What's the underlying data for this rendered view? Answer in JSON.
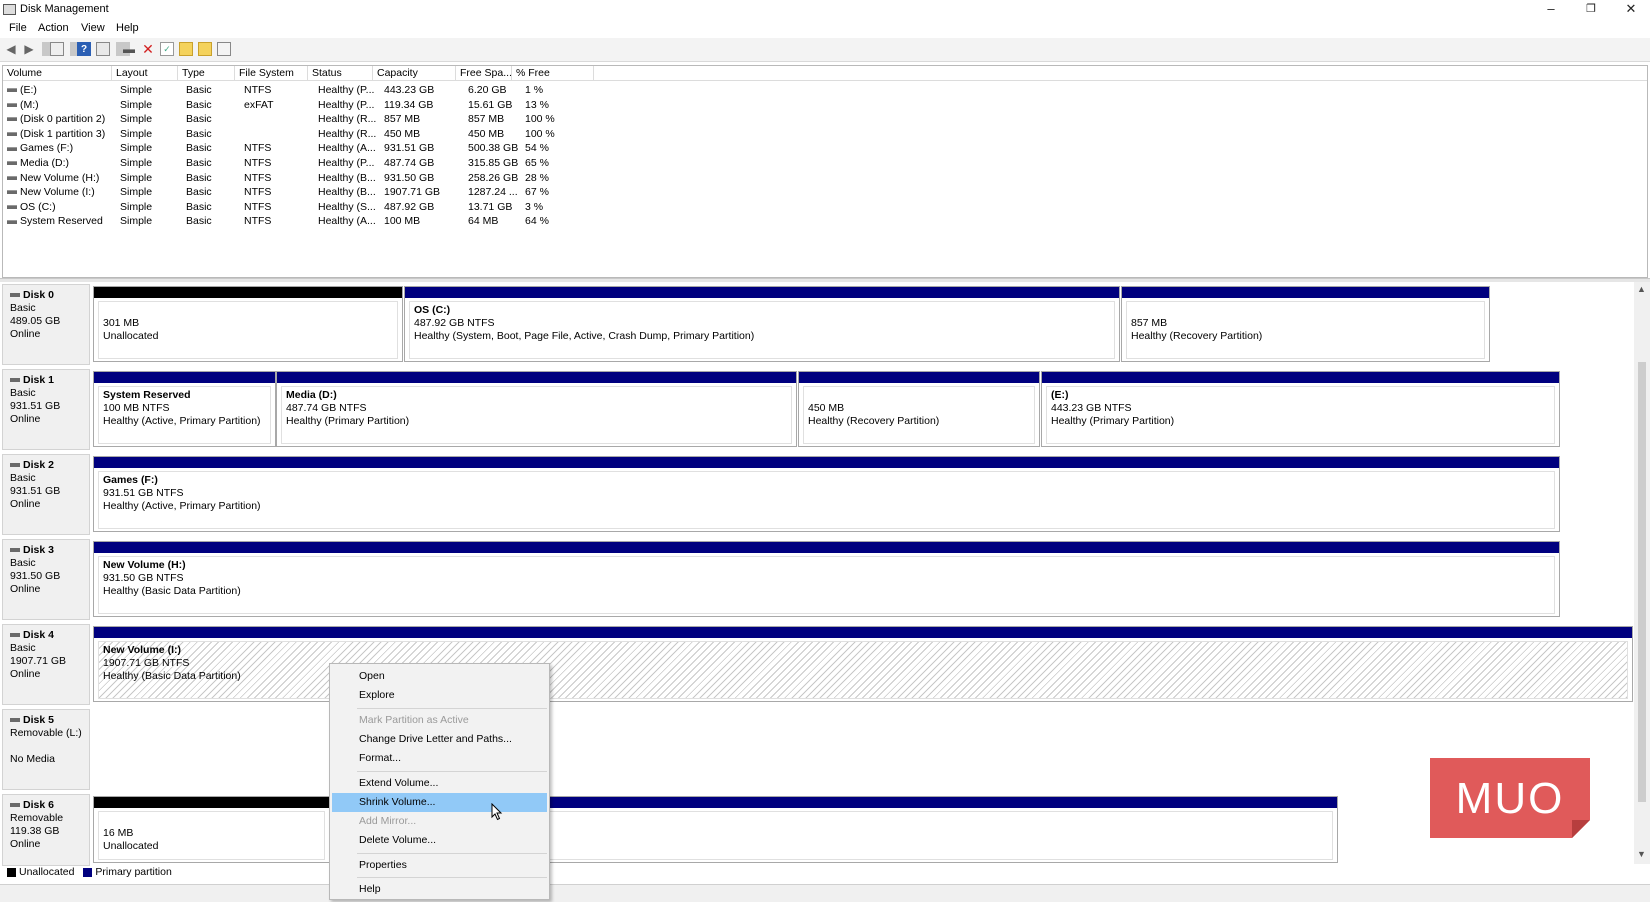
{
  "window": {
    "title": "Disk Management",
    "minimize_glyph": "–",
    "restore_glyph": "❐",
    "close_glyph": "✕"
  },
  "menu": [
    "File",
    "Action",
    "View",
    "Help"
  ],
  "volume_list": {
    "columns": [
      "Volume",
      "Layout",
      "Type",
      "File System",
      "Status",
      "Capacity",
      "Free Spa...",
      "% Free"
    ],
    "rows": [
      [
        "(E:)",
        "Simple",
        "Basic",
        "NTFS",
        "Healthy (P...",
        "443.23 GB",
        "6.20 GB",
        "1 %"
      ],
      [
        "(M:)",
        "Simple",
        "Basic",
        "exFAT",
        "Healthy (P...",
        "119.34 GB",
        "15.61 GB",
        "13 %"
      ],
      [
        "(Disk 0 partition 2)",
        "Simple",
        "Basic",
        "",
        "Healthy (R...",
        "857 MB",
        "857 MB",
        "100 %"
      ],
      [
        "(Disk 1 partition 3)",
        "Simple",
        "Basic",
        "",
        "Healthy (R...",
        "450 MB",
        "450 MB",
        "100 %"
      ],
      [
        "Games (F:)",
        "Simple",
        "Basic",
        "NTFS",
        "Healthy (A...",
        "931.51 GB",
        "500.38 GB",
        "54 %"
      ],
      [
        "Media (D:)",
        "Simple",
        "Basic",
        "NTFS",
        "Healthy (P...",
        "487.74 GB",
        "315.85 GB",
        "65 %"
      ],
      [
        "New Volume (H:)",
        "Simple",
        "Basic",
        "NTFS",
        "Healthy (B...",
        "931.50 GB",
        "258.26 GB",
        "28 %"
      ],
      [
        "New Volume (I:)",
        "Simple",
        "Basic",
        "NTFS",
        "Healthy (B...",
        "1907.71 GB",
        "1287.24 ...",
        "67 %"
      ],
      [
        "OS (C:)",
        "Simple",
        "Basic",
        "NTFS",
        "Healthy (S...",
        "487.92 GB",
        "13.71 GB",
        "3 %"
      ],
      [
        "System Reserved",
        "Simple",
        "Basic",
        "NTFS",
        "Healthy (A...",
        "100 MB",
        "64 MB",
        "64 %"
      ]
    ]
  },
  "disks": [
    {
      "name": "Disk 0",
      "kind": "Basic",
      "size": "489.05 GB",
      "state": "Online",
      "partitions": [
        {
          "bar": "unalloc",
          "title": "",
          "line1": "301 MB",
          "line2": "Unallocated"
        },
        {
          "bar": "primary",
          "title": "OS  (C:)",
          "line1": "487.92 GB NTFS",
          "line2": "Healthy (System, Boot, Page File, Active, Crash Dump, Primary Partition)"
        },
        {
          "bar": "primary",
          "title": "",
          "line1": "857 MB",
          "line2": "Healthy (Recovery Partition)"
        }
      ]
    },
    {
      "name": "Disk 1",
      "kind": "Basic",
      "size": "931.51 GB",
      "state": "Online",
      "partitions": [
        {
          "bar": "primary",
          "title": "System Reserved",
          "line1": "100 MB NTFS",
          "line2": "Healthy (Active, Primary Partition)"
        },
        {
          "bar": "primary",
          "title": "Media  (D:)",
          "line1": "487.74 GB NTFS",
          "line2": "Healthy (Primary Partition)"
        },
        {
          "bar": "primary",
          "title": "",
          "line1": "450 MB",
          "line2": "Healthy (Recovery Partition)"
        },
        {
          "bar": "primary",
          "title": "(E:)",
          "line1": "443.23 GB NTFS",
          "line2": "Healthy (Primary Partition)"
        }
      ]
    },
    {
      "name": "Disk 2",
      "kind": "Basic",
      "size": "931.51 GB",
      "state": "Online",
      "partitions": [
        {
          "bar": "primary",
          "title": "Games  (F:)",
          "line1": "931.51 GB NTFS",
          "line2": "Healthy (Active, Primary Partition)"
        }
      ]
    },
    {
      "name": "Disk 3",
      "kind": "Basic",
      "size": "931.50 GB",
      "state": "Online",
      "partitions": [
        {
          "bar": "primary",
          "title": "New Volume  (H:)",
          "line1": "931.50 GB NTFS",
          "line2": "Healthy (Basic Data Partition)"
        }
      ]
    },
    {
      "name": "Disk 4",
      "kind": "Basic",
      "size": "1907.71 GB",
      "state": "Online",
      "partitions": [
        {
          "bar": "primary",
          "title": "New Volume  (I:)",
          "line1": "1907.71 GB NTFS",
          "line2": "Healthy (Basic Data Partition)",
          "selected": true
        }
      ]
    },
    {
      "name": "Disk 5",
      "kind": "Removable (L:)",
      "size": "",
      "state": "No Media",
      "partitions": []
    },
    {
      "name": "Disk 6",
      "kind": "Removable",
      "size": "119.38 GB",
      "state": "Online",
      "partitions": [
        {
          "bar": "unalloc",
          "title": "",
          "line1": "16 MB",
          "line2": "Unallocated"
        },
        {
          "bar": "primary",
          "title": "",
          "line1": "",
          "line2": ""
        }
      ]
    }
  ],
  "legend": {
    "unallocated": "Unallocated",
    "primary": "Primary partition"
  },
  "context_menu": {
    "items": [
      {
        "label": "Open",
        "state": "enabled"
      },
      {
        "label": "Explore",
        "state": "enabled"
      },
      {
        "label": "Mark Partition as Active",
        "state": "disabled"
      },
      {
        "label": "Change Drive Letter and Paths...",
        "state": "enabled"
      },
      {
        "label": "Format...",
        "state": "enabled"
      },
      {
        "label": "Extend Volume...",
        "state": "enabled"
      },
      {
        "label": "Shrink Volume...",
        "state": "highlighted"
      },
      {
        "label": "Add Mirror...",
        "state": "disabled"
      },
      {
        "label": "Delete Volume...",
        "state": "enabled"
      },
      {
        "label": "Properties",
        "state": "enabled"
      },
      {
        "label": "Help",
        "state": "enabled"
      }
    ]
  },
  "watermark": "MUO",
  "colors": {
    "primary_bar": "#00007f",
    "unallocated_bar": "#000000",
    "menu_highlight": "#91c9f7",
    "watermark": "#e05a5a"
  }
}
